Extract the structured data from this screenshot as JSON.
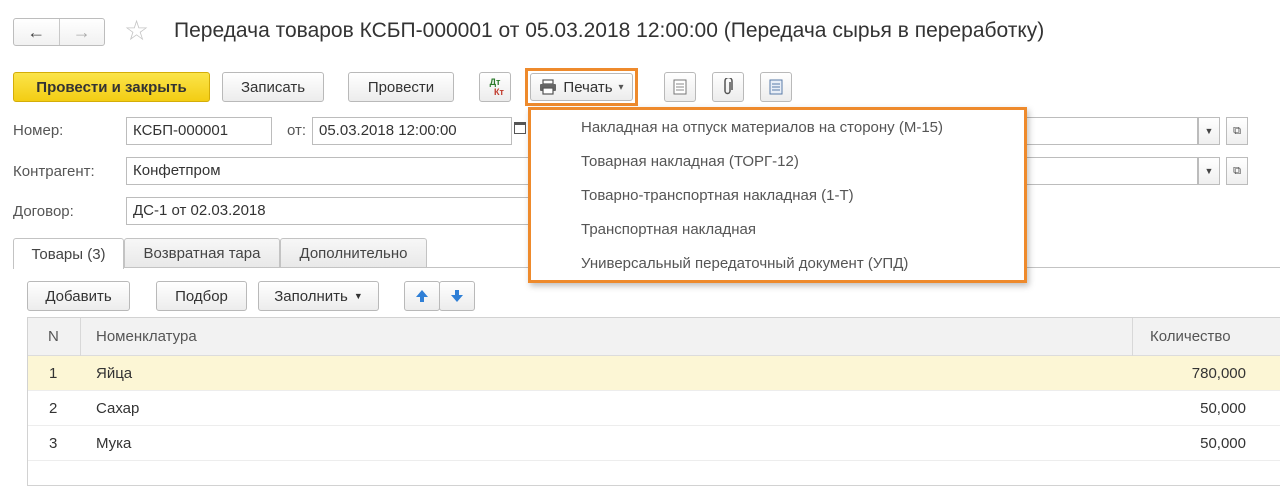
{
  "header": {
    "back_icon": "←",
    "forward_icon": "→",
    "star_icon": "☆",
    "title": "Передача товаров КСБП-000001 от 05.03.2018 12:00:00 (Передача сырья в переработку)"
  },
  "toolbar": {
    "post_close": "Провести и закрыть",
    "save": "Записать",
    "post": "Провести",
    "dtkt_top": "Дт",
    "dtkt_bottom": "Кт",
    "print": "Печать",
    "print_arrow": "▾"
  },
  "form": {
    "number_label": "Номер:",
    "number_value": "КСБП-000001",
    "date_label": "от:",
    "date_value": "05.03.2018 12:00:00",
    "counterparty_label": "Контрагент:",
    "counterparty_value": "Конфетпром",
    "contract_label": "Договор:",
    "contract_value": "ДС-1 от 02.03.2018"
  },
  "tabs": [
    {
      "label": "Товары (3)"
    },
    {
      "label": "Возвратная тара"
    },
    {
      "label": "Дополнительно"
    }
  ],
  "table_toolbar": {
    "add": "Добавить",
    "pick": "Подбор",
    "fill": "Заполнить"
  },
  "table": {
    "columns": {
      "n": "N",
      "item": "Номенклатура",
      "qty": "Количество"
    },
    "rows": [
      {
        "n": "1",
        "item": "Яйца",
        "qty": "780,000"
      },
      {
        "n": "2",
        "item": "Сахар",
        "qty": "50,000"
      },
      {
        "n": "3",
        "item": "Мука",
        "qty": "50,000"
      }
    ]
  },
  "print_menu": {
    "items": [
      {
        "label": "Накладная на отпуск материалов на сторону (М-15)"
      },
      {
        "label": "Товарная накладная (ТОРГ-12)"
      },
      {
        "label": "Товарно-транспортная накладная (1-Т)"
      },
      {
        "label": "Транспортная накладная"
      },
      {
        "label": "Универсальный передаточный документ (УПД)"
      }
    ]
  },
  "colors": {
    "primary_button": "#f3cd13",
    "menu_highlight_border": "#ee8a2c",
    "selected_row": "#fcf6d5",
    "arrow_blue": "#2f7fd6"
  }
}
